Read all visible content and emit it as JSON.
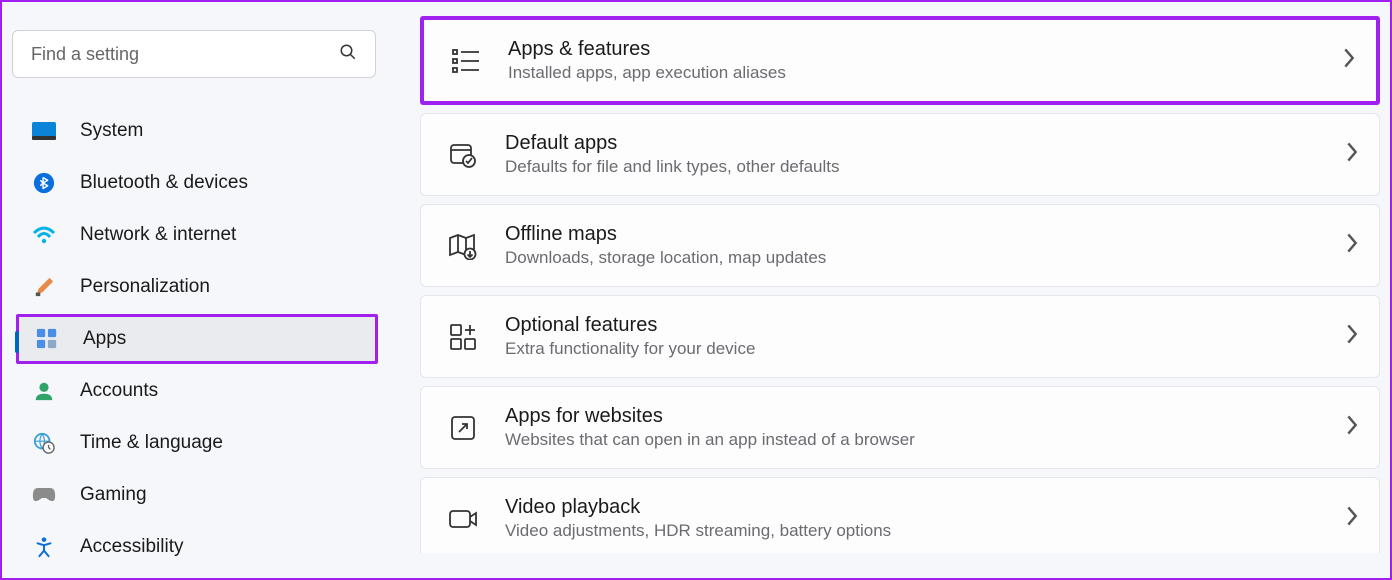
{
  "search": {
    "placeholder": "Find a setting"
  },
  "nav": {
    "system": "System",
    "bluetooth": "Bluetooth & devices",
    "network": "Network & internet",
    "personalization": "Personalization",
    "apps": "Apps",
    "accounts": "Accounts",
    "time": "Time & language",
    "gaming": "Gaming",
    "accessibility": "Accessibility"
  },
  "cards": {
    "apps_features": {
      "title": "Apps & features",
      "sub": "Installed apps, app execution aliases"
    },
    "default_apps": {
      "title": "Default apps",
      "sub": "Defaults for file and link types, other defaults"
    },
    "offline_maps": {
      "title": "Offline maps",
      "sub": "Downloads, storage location, map updates"
    },
    "optional_features": {
      "title": "Optional features",
      "sub": "Extra functionality for your device"
    },
    "apps_websites": {
      "title": "Apps for websites",
      "sub": "Websites that can open in an app instead of a browser"
    },
    "video_playback": {
      "title": "Video playback",
      "sub": "Video adjustments, HDR streaming, battery options"
    }
  }
}
